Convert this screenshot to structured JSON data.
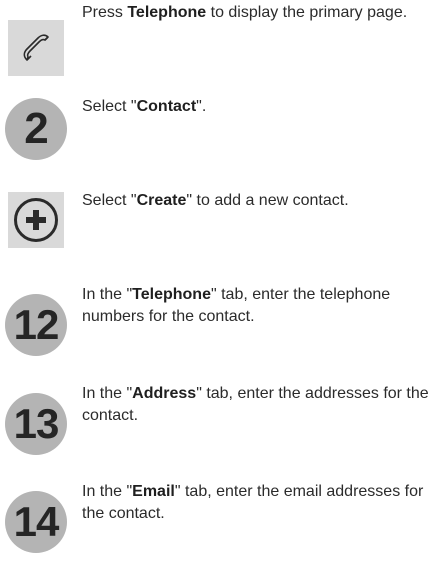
{
  "steps": [
    {
      "badge": "",
      "icon": "telephone-icon",
      "pre": "Press ",
      "bold": "Telephone",
      "post": " to display the primary page."
    },
    {
      "badge": "2",
      "pre": "Select \"",
      "bold": "Contact",
      "post": "\"."
    },
    {
      "badge": "",
      "icon": "plus-circle-icon",
      "pre": "Select \"",
      "bold": "Create",
      "post": "\" to add a new contact."
    },
    {
      "badge": "12",
      "pre": "In the \"",
      "bold": "Telephone",
      "post": "\" tab, enter the telephone numbers for the contact."
    },
    {
      "badge": "13",
      "pre": "In the \"",
      "bold": "Address",
      "post": "\" tab, enter the addresses for the contact."
    },
    {
      "badge": "14",
      "pre": "In the \"",
      "bold": "Email",
      "post": "\" tab, enter the email addresses for the contact."
    }
  ]
}
